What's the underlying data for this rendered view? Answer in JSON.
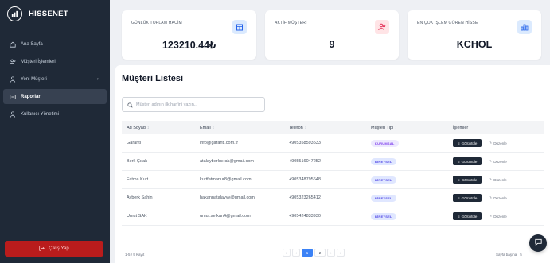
{
  "app": {
    "name": "HISSENET"
  },
  "sidebar": {
    "items": [
      {
        "label": "Ana Sayfa",
        "icon": "home-icon"
      },
      {
        "label": "Müşteri İşlemleri",
        "icon": "users-icon"
      },
      {
        "label": "Yeni Müşteri",
        "icon": "user-icon",
        "chevron": "›"
      },
      {
        "label": "Raporlar",
        "icon": "report-icon",
        "active": true
      },
      {
        "label": "Kullanıcı Yönetimi",
        "icon": "user-icon"
      }
    ],
    "logout_label": "Çıkış Yap"
  },
  "stats": [
    {
      "label": "GÜNLÜK TOPLAM HACİM",
      "value": "123210.44₺",
      "icon": "building-icon",
      "icon_color": "#2563eb",
      "icon_bg": "#dbeafe"
    },
    {
      "label": "AKTİF MÜŞTERİ",
      "value": "9",
      "icon": "users-icon",
      "icon_color": "#e11d48",
      "icon_bg": "#ffe4e6"
    },
    {
      "label": "EN ÇOK İŞLEM GÖREN HİSSE",
      "value": "KCHOL",
      "icon": "chart-bar-icon",
      "icon_color": "#2563eb",
      "icon_bg": "#dbeafe"
    }
  ],
  "customers": {
    "title": "Müşteri Listesi",
    "search_placeholder": "Müşteri adının ilk harfini yazın...",
    "columns": [
      "Ad Soyad",
      "Email",
      "Telefon",
      "Müşteri Tipi",
      "İşlemler"
    ],
    "sort_glyph": "↕",
    "view_label": "Görüntüle",
    "edit_label": "Düzenle",
    "rows": [
      {
        "name": "Garanti",
        "email": "info@garanti.com.tr",
        "phone": "+905358593533",
        "type": "KURUMSAL"
      },
      {
        "name": "Berk Çırak",
        "email": "atalayberkcırak@gmail.com",
        "phone": "+905516047252",
        "type": "BİREYSEL"
      },
      {
        "name": "Fatma Kurt",
        "email": "kurtfatmanur8@gmail.com",
        "phone": "+905348795648",
        "type": "BİREYSEL"
      },
      {
        "name": "Ayberk Şahin",
        "email": "hakannatalayyy@gmail.com",
        "phone": "+905323265412",
        "type": "BİREYSEL"
      },
      {
        "name": "Umut SAK",
        "email": "umut.sefkan4@gmail.com",
        "phone": "+905424833930",
        "type": "BİREYSEL"
      }
    ]
  },
  "pagination": {
    "count_text": "1-5 / 9 Kayıt",
    "first": "«",
    "prev": "‹",
    "pages": [
      "1",
      "2"
    ],
    "current": "1",
    "next": "›",
    "last": "»",
    "per_page_label": "Sayfa başına",
    "per_page_value": "5"
  },
  "colors": {
    "sidebar_bg": "#1f2937",
    "logout_bg": "#b91c1c",
    "accent": "#3b82f6"
  }
}
